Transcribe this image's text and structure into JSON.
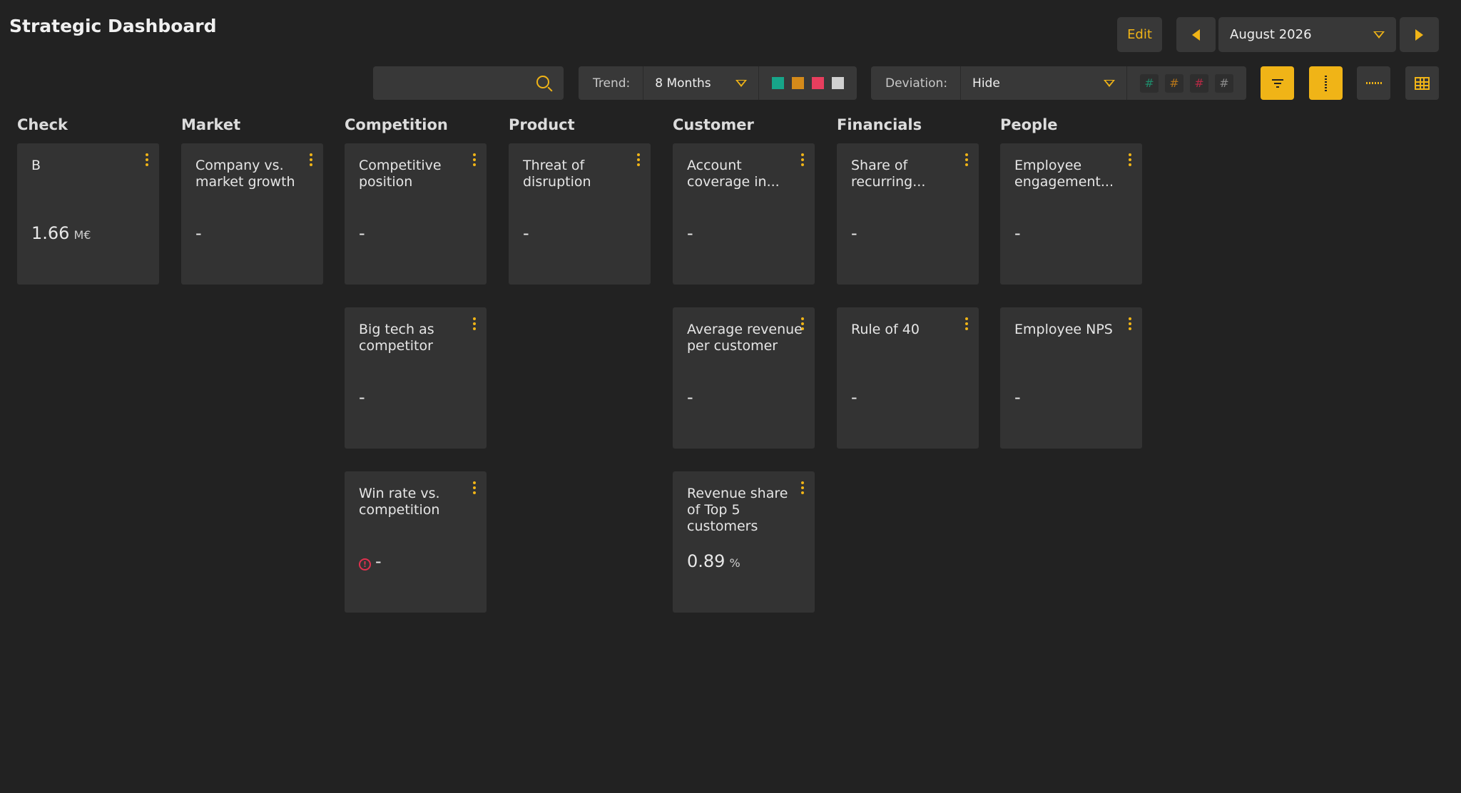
{
  "header": {
    "title": "Strategic Dashboard"
  },
  "top_controls": {
    "edit_label": "Edit",
    "month_value": "August 2026"
  },
  "toolbar": {
    "search_placeholder": "",
    "trend_label": "Trend:",
    "trend_value": "8 Months",
    "trend_colors": [
      "#17a589",
      "#d48a1a",
      "#e83e5e",
      "#d0d0d0"
    ],
    "deviation_label": "Deviation:",
    "deviation_value": "Hide",
    "deviation_hashes": [
      {
        "symbol": "#",
        "color": "#1f8a6a"
      },
      {
        "symbol": "#",
        "color": "#b5751a"
      },
      {
        "symbol": "#",
        "color": "#b52a45"
      },
      {
        "symbol": "#",
        "color": "#8a8a8a"
      }
    ]
  },
  "accent_color": "#f0b417",
  "columns": [
    {
      "name": "Check",
      "cards": [
        {
          "title": "B",
          "value": "1.66",
          "unit": "M€",
          "warning": false
        }
      ]
    },
    {
      "name": "Market",
      "cards": [
        {
          "title": "Company vs. market growth",
          "value": "-",
          "unit": "",
          "warning": false
        }
      ]
    },
    {
      "name": "Competition",
      "cards": [
        {
          "title": "Competitive position",
          "value": "-",
          "unit": "",
          "warning": false
        },
        {
          "title": "Big tech as competitor",
          "value": "-",
          "unit": "",
          "warning": false
        },
        {
          "title": "Win rate vs. competition",
          "value": "-",
          "unit": "",
          "warning": true
        }
      ]
    },
    {
      "name": "Product",
      "cards": [
        {
          "title": "Threat of disruption",
          "value": "-",
          "unit": "",
          "warning": false
        }
      ]
    },
    {
      "name": "Customer",
      "cards": [
        {
          "title": "Account coverage in...",
          "value": "-",
          "unit": "",
          "warning": false
        },
        {
          "title": "Average revenue per customer",
          "value": "-",
          "unit": "",
          "warning": false
        },
        {
          "title": "Revenue share of Top 5 customers",
          "value": "0.89",
          "unit": "%",
          "warning": false
        }
      ]
    },
    {
      "name": "Financials",
      "cards": [
        {
          "title": "Share of recurring...",
          "value": "-",
          "unit": "",
          "warning": false
        },
        {
          "title": "Rule of 40",
          "value": "-",
          "unit": "",
          "warning": false
        }
      ]
    },
    {
      "name": "People",
      "cards": [
        {
          "title": "Employee engagement...",
          "value": "-",
          "unit": "",
          "warning": false
        },
        {
          "title": "Employee NPS",
          "value": "-",
          "unit": "",
          "warning": false
        }
      ]
    }
  ]
}
